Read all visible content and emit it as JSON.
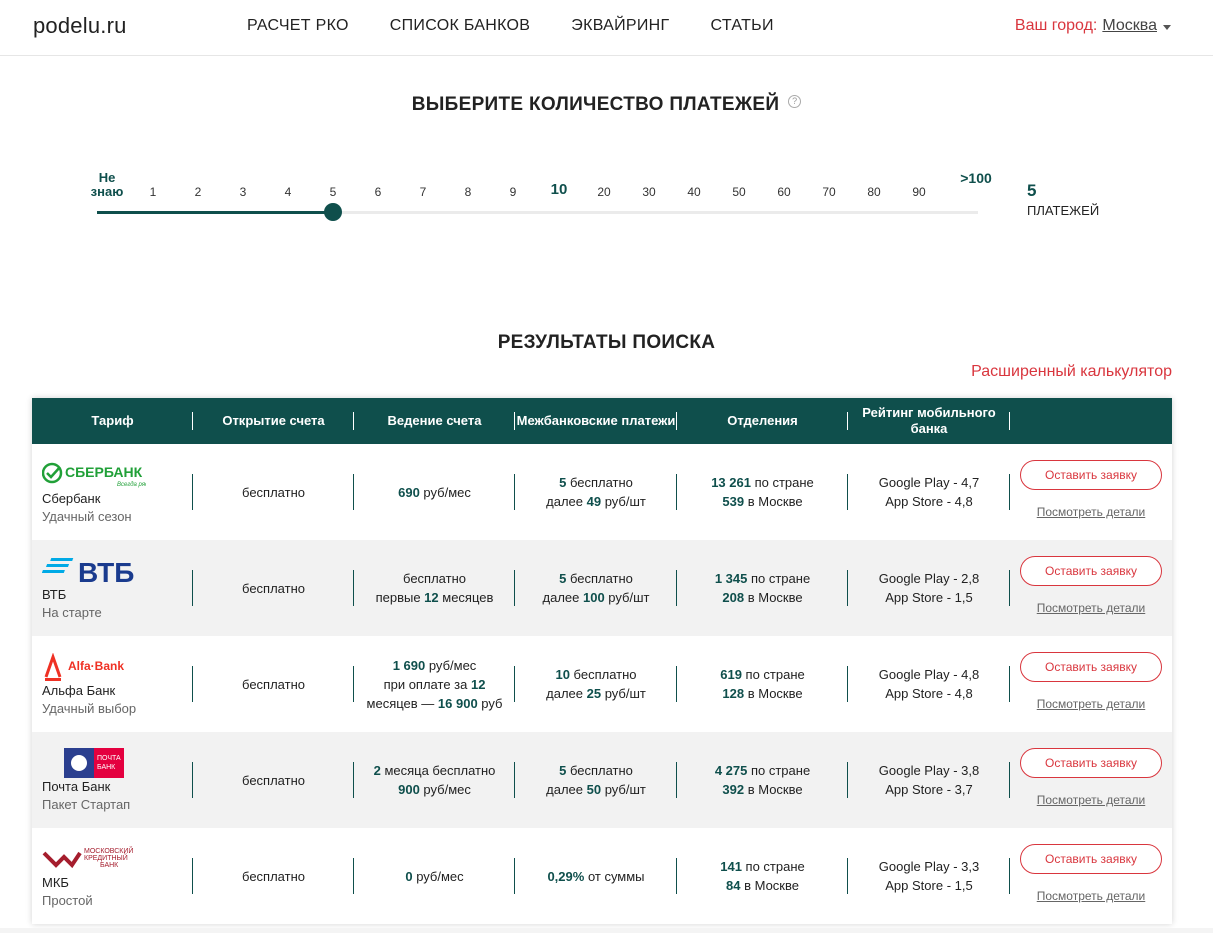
{
  "header": {
    "logo": "podelu.ru",
    "nav": [
      "РАСЧЕТ РКО",
      "СПИСОК БАНКОВ",
      "ЭКВАЙРИНГ",
      "СТАТЬИ"
    ],
    "city_label": "Ваш город:",
    "city_value": "Москва"
  },
  "payments": {
    "title": "ВЫБЕРИТЕ КОЛИЧЕСТВО ПЛАТЕЖЕЙ",
    "help": "?",
    "ticks": [
      "Не знаю",
      "1",
      "2",
      "3",
      "4",
      "5",
      "6",
      "7",
      "8",
      "9",
      "10",
      "20",
      "30",
      "40",
      "50",
      "60",
      "70",
      "80",
      "90",
      ">100"
    ],
    "selected_index": 5,
    "value": "5",
    "unit": "ПЛАТЕЖЕЙ"
  },
  "results": {
    "title": "РЕЗУЛЬТАТЫ ПОИСКА",
    "advanced_calc": "Расширенный калькулятор",
    "columns": [
      "Тариф",
      "Открытие счета",
      "Ведение счета",
      "Межбанковские платежи",
      "Отделения",
      "Рейтинг мобильного банка",
      ""
    ],
    "apply_label": "Оставить заявку",
    "details_label": "Посмотреть детали",
    "rows": [
      {
        "logo": "sberbank-logo",
        "logo_text": "СБЕРБАНК",
        "logo_sub": "Всегда рядом",
        "bank": "Сбербанк",
        "tariff": "Удачный сезон",
        "opening": "бесплатно",
        "maintenance": [
          {
            "b": "690",
            "t": " руб/мес"
          }
        ],
        "maintenance2": [],
        "maintenance3": [],
        "transfers1": [
          {
            "b": "5",
            "t": " бесплатно"
          }
        ],
        "transfers2": [
          {
            "b": "",
            "t": "далее "
          },
          {
            "b": "49",
            "t": " руб/шт"
          }
        ],
        "branches1": [
          {
            "b": "13 261",
            "t": " по стране"
          }
        ],
        "branches2": [
          {
            "b": "539",
            "t": " в Москве"
          }
        ],
        "rating1": "Google Play - 4,7",
        "rating2": "App Store - 4,8"
      },
      {
        "logo": "vtb-logo",
        "logo_text": "ВТБ",
        "logo_sub": "",
        "bank": "ВТБ",
        "tariff": "На старте",
        "opening": "бесплатно",
        "maintenance": [
          {
            "b": "",
            "t": "бесплатно"
          }
        ],
        "maintenance2": [
          {
            "b": "",
            "t": "первые "
          },
          {
            "b": "12",
            "t": " месяцев"
          }
        ],
        "maintenance3": [],
        "transfers1": [
          {
            "b": "5",
            "t": " бесплатно"
          }
        ],
        "transfers2": [
          {
            "b": "",
            "t": "далее "
          },
          {
            "b": "100",
            "t": " руб/шт"
          }
        ],
        "branches1": [
          {
            "b": "1 345",
            "t": " по стране"
          }
        ],
        "branches2": [
          {
            "b": "208",
            "t": " в Москве"
          }
        ],
        "rating1": "Google Play - 2,8",
        "rating2": "App Store - 1,5"
      },
      {
        "logo": "alfa-bank-logo",
        "logo_text": "Alfa·Bank",
        "logo_sub": "",
        "bank": "Альфа Банк",
        "tariff": "Удачный выбор",
        "opening": "бесплатно",
        "maintenance": [
          {
            "b": "1 690",
            "t": " руб/мес"
          }
        ],
        "maintenance2": [
          {
            "b": "",
            "t": "при оплате за "
          },
          {
            "b": "12",
            "t": ""
          }
        ],
        "maintenance3": [
          {
            "b": "",
            "t": "месяцев — "
          },
          {
            "b": "16 900",
            "t": " руб"
          }
        ],
        "transfers1": [
          {
            "b": "10",
            "t": " бесплатно"
          }
        ],
        "transfers2": [
          {
            "b": "",
            "t": "далее "
          },
          {
            "b": "25",
            "t": " руб/шт"
          }
        ],
        "branches1": [
          {
            "b": "619",
            "t": " по стране"
          }
        ],
        "branches2": [
          {
            "b": "128",
            "t": " в Москве"
          }
        ],
        "rating1": "Google Play - 4,8",
        "rating2": "App Store - 4,8"
      },
      {
        "logo": "pochta-bank-logo",
        "logo_text": "ПОЧТА БАНК",
        "logo_sub": "",
        "bank": "Почта Банк",
        "tariff": "Пакет Стартап",
        "opening": "бесплатно",
        "maintenance": [
          {
            "b": "2",
            "t": " месяца бесплатно"
          }
        ],
        "maintenance2": [
          {
            "b": "900",
            "t": " руб/мес"
          }
        ],
        "maintenance3": [],
        "transfers1": [
          {
            "b": "5",
            "t": " бесплатно"
          }
        ],
        "transfers2": [
          {
            "b": "",
            "t": "далее "
          },
          {
            "b": "50",
            "t": " руб/шт"
          }
        ],
        "branches1": [
          {
            "b": "4 275",
            "t": " по стране"
          }
        ],
        "branches2": [
          {
            "b": "392",
            "t": " в Москве"
          }
        ],
        "rating1": "Google Play - 3,8",
        "rating2": "App Store - 3,7"
      },
      {
        "logo": "mkb-logo",
        "logo_text": "МОСКОВСКИЙ КРЕДИТНЫЙ БАНК",
        "logo_sub": "",
        "bank": "МКБ",
        "tariff": "Простой",
        "opening": "бесплатно",
        "maintenance": [
          {
            "b": "0",
            "t": " руб/мес"
          }
        ],
        "maintenance2": [],
        "maintenance3": [],
        "transfers1": [
          {
            "b": "0,29%",
            "t": " от суммы"
          }
        ],
        "transfers2": [],
        "branches1": [
          {
            "b": "141",
            "t": " по стране"
          }
        ],
        "branches2": [
          {
            "b": "84",
            "t": " в Москве"
          }
        ],
        "rating1": "Google Play - 3,3",
        "rating2": "App Store - 1,5"
      }
    ]
  },
  "colors": {
    "brand": "#0f4f4c",
    "accent": "#d9363e",
    "row_alt": "#f2f2f2"
  }
}
